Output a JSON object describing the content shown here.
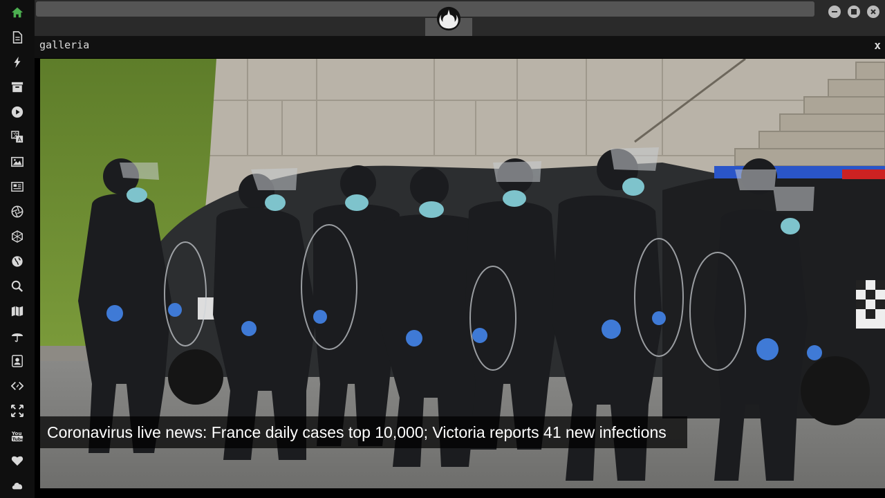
{
  "colors": {
    "sidebar_bg": "#0f0f0f",
    "icon_default": "#d8d8d8",
    "icon_active": "#4caf50",
    "topbar_bg": "#2a2a2a",
    "panel_bg": "#111111"
  },
  "sidebar": {
    "items": [
      {
        "icon": "home-icon",
        "active": true
      },
      {
        "icon": "document-icon"
      },
      {
        "icon": "lightning-icon"
      },
      {
        "icon": "archive-icon"
      },
      {
        "icon": "play-icon"
      },
      {
        "icon": "translate-icon"
      },
      {
        "icon": "image-icon"
      },
      {
        "icon": "newspaper-icon"
      },
      {
        "icon": "aperture-icon"
      },
      {
        "icon": "hexagon-icon"
      },
      {
        "icon": "globe-icon"
      },
      {
        "icon": "search-icon"
      },
      {
        "icon": "map-icon"
      },
      {
        "icon": "umbrella-icon"
      },
      {
        "icon": "contact-icon"
      },
      {
        "icon": "code-icon"
      },
      {
        "icon": "expand-icon"
      },
      {
        "icon": "youtube-icon"
      },
      {
        "icon": "heart-icon"
      },
      {
        "icon": "cloud-icon"
      }
    ]
  },
  "titlebar": {
    "logo": "rebel-alliance-logo",
    "controls": [
      "minimize-icon",
      "maximize-icon",
      "close-icon"
    ]
  },
  "panel": {
    "title": "galleria",
    "close_label": "x"
  },
  "gallery": {
    "caption": "Coronavirus live news: France daily cases top 10,000; Victoria reports 41 new infections"
  }
}
